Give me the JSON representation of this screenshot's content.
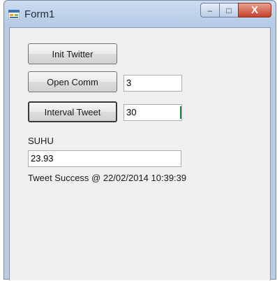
{
  "window": {
    "title": "Form1",
    "icon": "winforms-app-icon",
    "controls": {
      "minimize": "–",
      "maximize": "□",
      "close": "X"
    }
  },
  "buttons": {
    "init_twitter": "Init Twitter",
    "open_comm": "Open Comm",
    "interval_tweet": "Interval Tweet"
  },
  "inputs": {
    "comm_port": "3",
    "interval": "30",
    "suhu_value": "23.93"
  },
  "labels": {
    "suhu": "SUHU",
    "status": "Tweet Success @ 22/02/2014 10:39:39"
  }
}
